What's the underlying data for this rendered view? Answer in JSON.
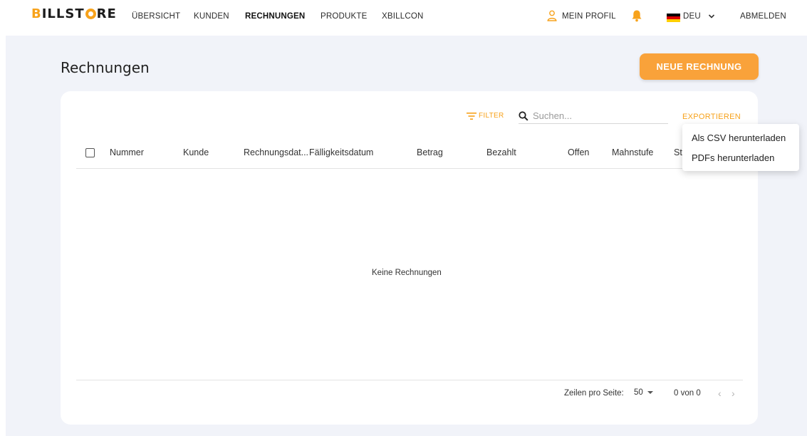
{
  "brand": {
    "prefix": "B",
    "part1": "ILLST",
    "part2": "RE"
  },
  "nav": {
    "items": [
      {
        "label": "ÜBERSICHT",
        "active": false
      },
      {
        "label": "KUNDEN",
        "active": false
      },
      {
        "label": "RECHNUNGEN",
        "active": true
      },
      {
        "label": "PRODUKTE",
        "active": false
      },
      {
        "label": "XBILLCON",
        "active": false
      }
    ],
    "profile_label": "MEIN PROFIL",
    "language_label": "DEU",
    "logout_label": "ABMELDEN"
  },
  "page": {
    "title": "Rechnungen",
    "new_button": "NEUE RECHNUNG"
  },
  "toolbar": {
    "filter_label": "FILTER",
    "search_placeholder": "Suchen...",
    "export_label": "EXPORTIEREN"
  },
  "export_menu": {
    "items": [
      "Als CSV herunterladen",
      "PDFs herunterladen"
    ]
  },
  "table": {
    "columns": [
      "Nummer",
      "Kunde",
      "Rechnungsdat...",
      "Fälligkeitsdatum",
      "Betrag",
      "Bezahlt",
      "Offen",
      "Mahnstufe",
      "St"
    ],
    "empty_text": "Keine Rechnungen"
  },
  "pagination": {
    "rows_per_page_label": "Zeilen pro Seite:",
    "rows_per_page_value": "50",
    "range_text": "0 von 0"
  },
  "colors": {
    "accent": "#f7a21b",
    "button": "#f9a23a",
    "background": "#f1f3f9"
  }
}
